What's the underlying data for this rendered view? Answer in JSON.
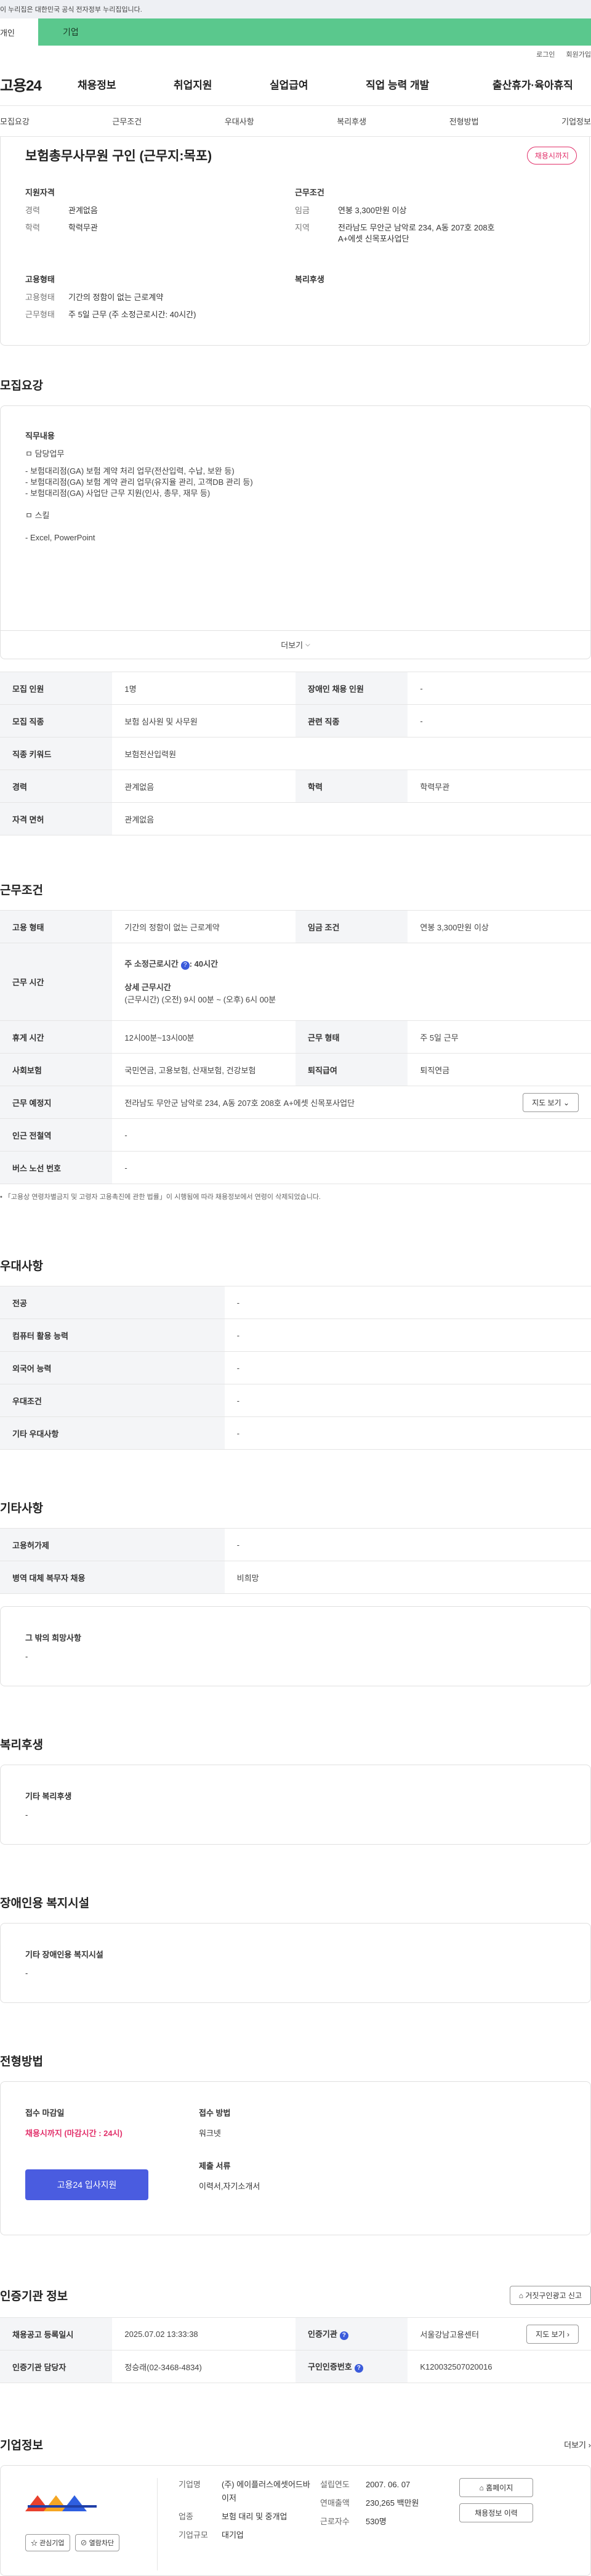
{
  "gov_banner": "이 누리집은 대한민국 공식 전자정부 누리집입니다.",
  "tabs": {
    "personal": "개인",
    "company": "기업"
  },
  "util": {
    "login": "로그인",
    "join": "회원가입"
  },
  "logo": "고용24",
  "gnb": [
    "채용정보",
    "취업지원",
    "실업급여",
    "직업 능력 개발",
    "출산휴가·육아휴직"
  ],
  "subnav": [
    "모집요강",
    "근무조건",
    "우대사항",
    "복리후생",
    "전형방법",
    "기업정보"
  ],
  "job": {
    "title": "보험총무사무원 구인 (근무지:목포)",
    "badge": "채용시까지",
    "qual_title": "지원자격",
    "career_k": "경력",
    "career_v": "관계없음",
    "edu_k": "학력",
    "edu_v": "학력무관",
    "emp_title": "고용형태",
    "emptype_k": "고용형태",
    "emptype_v": "기간의 정함이 없는 근로계약",
    "worktype_k": "근무형태",
    "worktype_v": "주 5일 근무 (주 소정근로시간: 40시간)",
    "cond_title": "근무조건",
    "wage_k": "임금",
    "wage_v": "연봉 3,300만원 이상",
    "region_k": "지역",
    "region_v": "전라남도 무안군 남악로 234, A동 207호 208호 A+에셋 신목포사업단",
    "welfare_title": "복리후생"
  },
  "recruit": {
    "section_title": "모집요강",
    "duty_title": "직무내용",
    "duty_lines": [
      "ㅁ 담당업무",
      "",
      "- 보험대리점(GA) 보험 계약 처리 업무(전산입력, 수납, 보완 등)",
      "- 보험대리점(GA) 보험 계약 관리 업무(유지율 관리, 고객DB 관리 등)",
      "- 보험대리점(GA) 사업단 근무 지원(인사, 총무, 재무 등)",
      "",
      "ㅁ 스킬",
      "",
      "- Excel, PowerPoint"
    ],
    "more": "더보기",
    "rows": [
      [
        "모집 인원",
        "1명",
        "장애인 채용 인원",
        "-"
      ],
      [
        "모집 직종",
        "보험 심사원 및 사무원",
        "관련 직종",
        "-"
      ],
      [
        "직종 키워드",
        "보험전산입력원",
        "",
        ""
      ],
      [
        "경력",
        "관계없음",
        "학력",
        "학력무관"
      ],
      [
        "자격 면허",
        "관계없음",
        "",
        ""
      ]
    ]
  },
  "work": {
    "section_title": "근무조건",
    "emp_k": "고용 형태",
    "emp_v": "기간의 정함이 없는 근로계약",
    "wage_k": "임금 조건",
    "wage_v": "연봉 3,300만원 이상",
    "hours_k": "근무 시간",
    "hours_line1": "주 소정근로시간",
    "hours_line1b": ": 40시간",
    "hours_line2": "상세 근무시간",
    "hours_line3": "(근무시간) (오전) 9시 00분 ~ (오후) 6시 00분",
    "break_k": "휴게 시간",
    "break_v": "12시00분~13시00분",
    "shape_k": "근무 형태",
    "shape_v": "주 5일 근무",
    "ins_k": "사회보험",
    "ins_v": "국민연금, 고용보험, 산재보험, 건강보험",
    "sev_k": "퇴직급여",
    "sev_v": "퇴직연금",
    "place_k": "근무 예정지",
    "place_v": "전라남도 무안군 남악로 234, A동 207호 208호 A+에셋 신목포사업단",
    "map_btn": "지도 보기",
    "transit_k": "인근 전철역",
    "transit_v": "-",
    "bus_k": "버스 노선 번호",
    "bus_v": "-",
    "notice": "「고용상 연령차별금지 및 고령자 고용촉진에 관한 법률」이 시행됨에 따라 채용정보에서 연령이 삭제되었습니다."
  },
  "pref": {
    "section_title": "우대사항",
    "rows": [
      [
        "전공",
        "-"
      ],
      [
        "컴퓨터 활용 능력",
        "-"
      ],
      [
        "외국어 능력",
        "-"
      ],
      [
        "우대조건",
        "-"
      ],
      [
        "기타 우대사항",
        "-"
      ]
    ]
  },
  "etc": {
    "section_title": "기타사항",
    "rows": [
      [
        "고용허가제",
        "-"
      ],
      [
        "병역 대체 복무자 채용",
        "비희망"
      ]
    ],
    "other_title": "그 밖의 희망사항",
    "other_v": "-"
  },
  "welfare": {
    "section_title": "복리후생",
    "sub": "기타 복리후생",
    "v": "-"
  },
  "disab": {
    "section_title": "장애인용 복지시설",
    "sub": "기타 장애인용 복지시설",
    "v": "-"
  },
  "process": {
    "section_title": "전형방법",
    "deadline_k": "접수 마감일",
    "deadline_v": "채용시까지 (마감시간 : 24시)",
    "apply_btn": "고용24 입사지원",
    "method_k": "접수 방법",
    "method_v": "워크넷",
    "docs_k": "제출 서류",
    "docs_v": "이력서,자기소개서"
  },
  "cert": {
    "section_title": "인증기관 정보",
    "report_btn": "거짓구인광고 신고",
    "reg_k": "채용공고 등록일시",
    "reg_v": "2025.07.02 13:33:38",
    "org_k": "인증기관",
    "org_v": "서울강남고용센터",
    "mgr_k": "인증기관 담당자",
    "mgr_v": "정승래(02-3468-4834)",
    "num_k": "구인인증번호",
    "num_v": "K120032507020016",
    "map_btn": "지도 보기"
  },
  "company": {
    "section_title": "기업정보",
    "more": "더보기",
    "fav_btn": "관심기업",
    "block_btn": "열람차단",
    "name_k": "기업명",
    "name_v": "(주) 에이플러스에셋어드바이저",
    "ind_k": "업종",
    "ind_v": "보험 대리 및 중개업",
    "size_k": "기업규모",
    "size_v": "대기업",
    "est_k": "설립연도",
    "est_v": "2007. 06. 07",
    "sales_k": "연매출액",
    "sales_v": "230,265 백만원",
    "emp_k": "근로자수",
    "emp_v": "530명",
    "home_btn": "홈페이지",
    "jobs_btn": "채용정보 이력",
    "brand_colors": [
      "#e8412d",
      "#f5a623",
      "#2f5fe0"
    ]
  }
}
